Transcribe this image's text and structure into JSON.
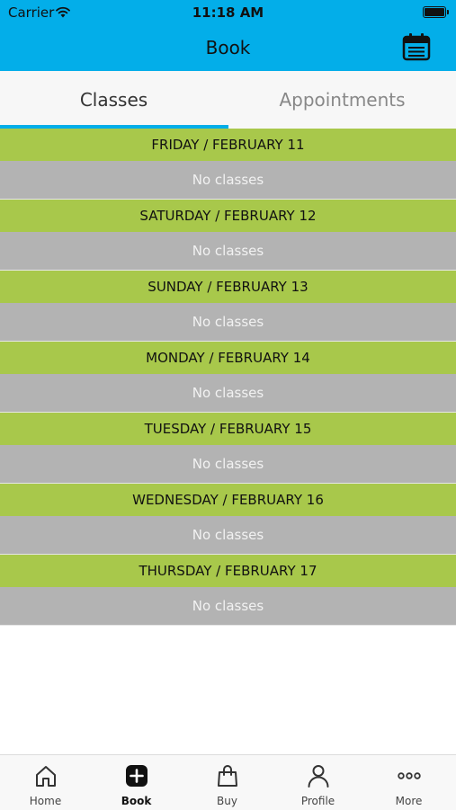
{
  "status_bar": {
    "carrier": "Carrier",
    "time": "11:18 AM"
  },
  "nav": {
    "title": "Book"
  },
  "tabs": [
    {
      "label": "Classes",
      "active": true
    },
    {
      "label": "Appointments",
      "active": false
    }
  ],
  "days": [
    {
      "header": "FRIDAY / FEBRUARY 11",
      "body": "No classes"
    },
    {
      "header": "SATURDAY / FEBRUARY 12",
      "body": "No classes"
    },
    {
      "header": "SUNDAY / FEBRUARY 13",
      "body": "No classes"
    },
    {
      "header": "MONDAY / FEBRUARY 14",
      "body": "No classes"
    },
    {
      "header": "TUESDAY / FEBRUARY 15",
      "body": "No classes"
    },
    {
      "header": "WEDNESDAY / FEBRUARY 16",
      "body": "No classes"
    },
    {
      "header": "THURSDAY / FEBRUARY 17",
      "body": "No classes"
    }
  ],
  "tabbar": [
    {
      "label": "Home",
      "icon": "home-icon"
    },
    {
      "label": "Book",
      "icon": "plus-square-icon",
      "active": true
    },
    {
      "label": "Buy",
      "icon": "bag-icon"
    },
    {
      "label": "Profile",
      "icon": "person-icon"
    },
    {
      "label": "More",
      "icon": "more-icon"
    }
  ],
  "colors": {
    "header_bg": "#03aee9",
    "day_header_bg": "#a8c84b",
    "day_body_bg": "#b3b3b3",
    "tab_indicator": "#03aee9"
  }
}
